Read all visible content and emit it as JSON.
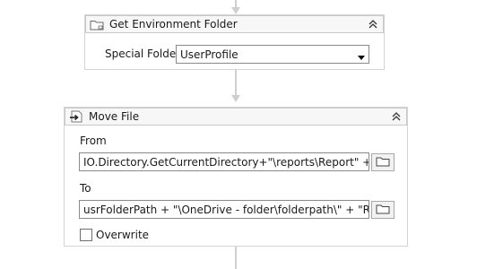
{
  "get_env_folder": {
    "title": "Get Environment Folder",
    "special_folder_label": "Special Folder",
    "special_folder_value": "UserProfile",
    "icon": "folder-icon"
  },
  "move_file": {
    "title": "Move File",
    "from_label": "From",
    "from_value": "IO.Directory.GetCurrentDirectory+\"\\reports\\Report\" +\"_\"+fc",
    "to_label": "To",
    "to_value": "usrFolderPath + \"\\OneDrive - folder\\folderpath\\\" + \"Report",
    "overwrite_label": "Overwrite",
    "overwrite_checked": false,
    "icon": "move-file-icon"
  },
  "colors": {
    "connector": "#cfcfcf",
    "border": "#d4d4d4",
    "header_bg": "#f7f7f7"
  }
}
